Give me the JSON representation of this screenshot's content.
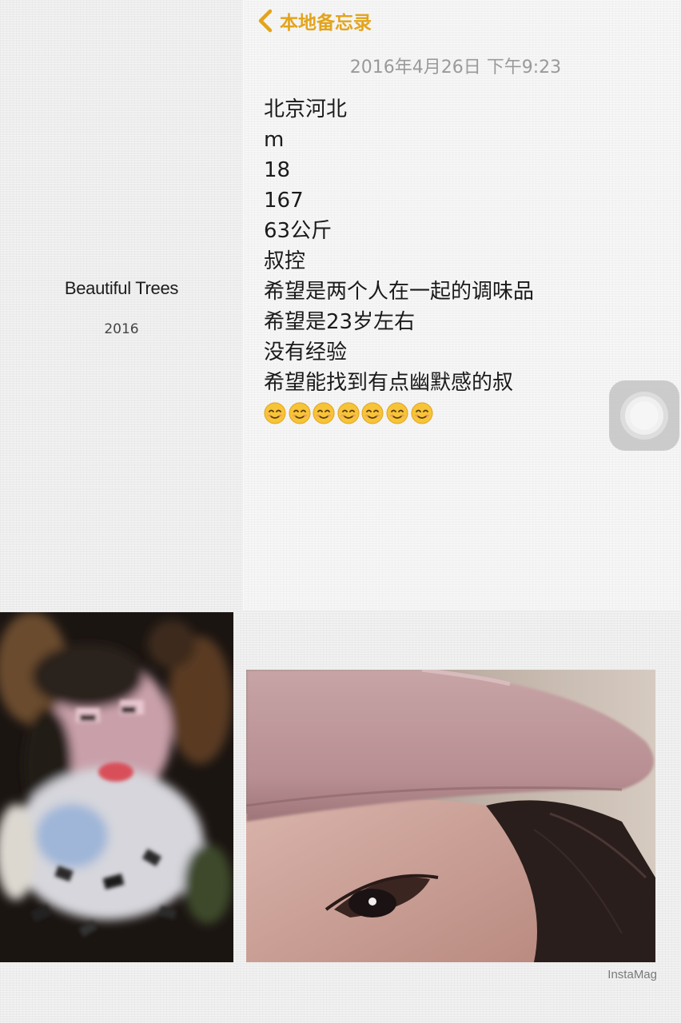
{
  "album": {
    "title": "Beautiful Trees",
    "year": "2016"
  },
  "note": {
    "back_label": "本地备忘录",
    "date": "2016年4月26日 下午9:23",
    "lines": [
      "北京河北",
      "m",
      "18",
      "167",
      "63公斤",
      "叔控",
      "希望是两个人在一起的调味品",
      "希望是23岁左右",
      "没有经验",
      "希望能找到有点幽默感的叔"
    ],
    "emoji_count": 7
  },
  "watermark": "InstaMag",
  "colors": {
    "accent": "#e3a41c",
    "date_text": "#9a9a9a",
    "body_text": "#1a1a1a",
    "background": "#ebebeb"
  },
  "icons": {
    "back": "chevron-left-icon",
    "emoji": "smiling-face-icon",
    "assistive_touch": "assistive-touch-icon"
  }
}
